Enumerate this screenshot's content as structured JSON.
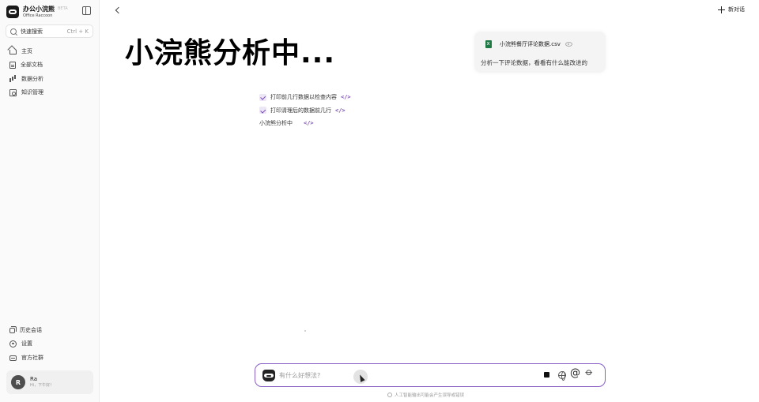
{
  "app": {
    "name_cn": "办公小浣熊",
    "name_en": "Office Raccoon",
    "beta": "BETA"
  },
  "sidebar": {
    "search_label": "快速搜索",
    "search_shortcut": "Ctrl + K",
    "items": [
      {
        "label": "主页",
        "icon": "home-icon"
      },
      {
        "label": "全部文档",
        "icon": "document-icon"
      },
      {
        "label": "数据分析",
        "icon": "chart-icon"
      },
      {
        "label": "知识管理",
        "icon": "knowledge-icon"
      }
    ],
    "bottom_items": [
      {
        "label": "历史会话",
        "icon": "history-icon"
      },
      {
        "label": "设置",
        "icon": "settings-icon"
      },
      {
        "label": "官方社群",
        "icon": "community-icon"
      }
    ],
    "user": {
      "initial": "R",
      "name": "Ra",
      "greeting": "Hi，下午好！"
    }
  },
  "header": {
    "new_chat_label": "新对话"
  },
  "overlay_caption": "小浣熊分析中...",
  "message": {
    "file_name": "小浣熊餐厅评论数据.csv",
    "text": "分析一下评论数据，看看有什么能改进的"
  },
  "steps": [
    {
      "label": "打印前几行数据以检查内容",
      "done": true
    },
    {
      "label": "打印清理后的数据前几行",
      "done": true
    }
  ],
  "status_text": "小浣熊分析中",
  "composer": {
    "placeholder": "有什么好想法?"
  },
  "disclaimer": "人工智能输出可能会产生误导或错误",
  "colors": {
    "accent": "#8a5fc4",
    "excel_green": "#1d7a44"
  }
}
